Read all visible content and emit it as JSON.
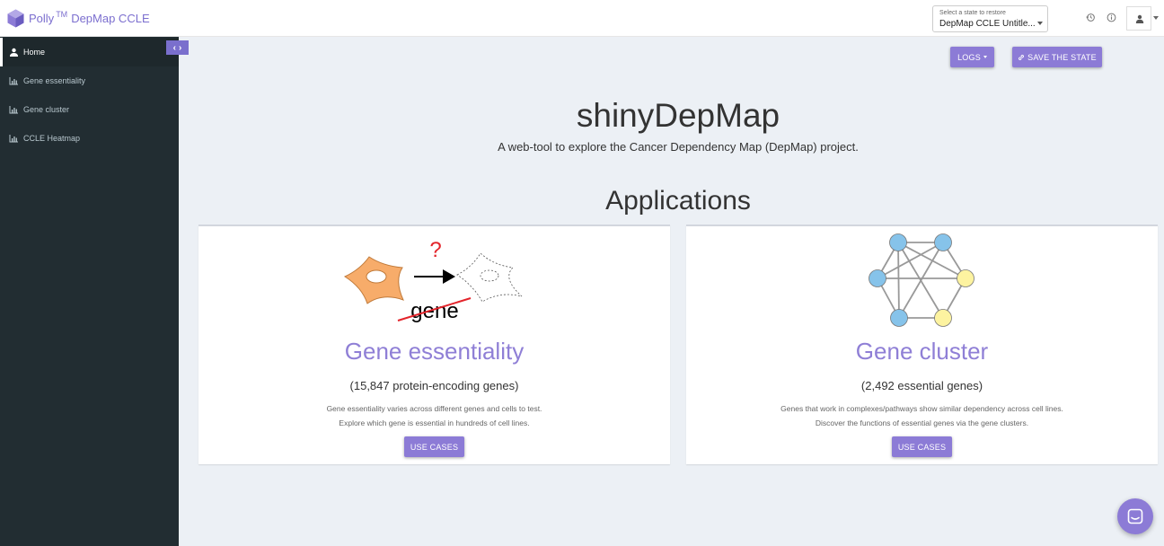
{
  "header": {
    "brand_name": "Polly",
    "brand_tm": "TM",
    "brand_rest": "DepMap CCLE",
    "state_selector": {
      "label": "Select a state to restore",
      "value": "DepMap CCLE Untitle..."
    },
    "icons": [
      "history-icon",
      "info-icon",
      "user-icon"
    ]
  },
  "sidebar": {
    "items": [
      {
        "label": "Home",
        "icon": "home-icon",
        "active": true
      },
      {
        "label": "Gene essentiality",
        "icon": "bar-chart-icon",
        "active": false
      },
      {
        "label": "Gene cluster",
        "icon": "bar-chart-icon",
        "active": false
      },
      {
        "label": "CCLE Heatmap",
        "icon": "bar-chart-icon",
        "active": false
      }
    ]
  },
  "toolbar": {
    "logs_label": "LOGS",
    "save_label": "SAVE THE STATE"
  },
  "main": {
    "title": "shinyDepMap",
    "subtitle": "A web-tool to explore the Cancer Dependency Map (DepMap) project.",
    "apps_heading": "Applications",
    "cards": [
      {
        "title": "Gene essentiality",
        "count": "(15,847 protein-encoding genes)",
        "desc_line1": "Gene essentiality varies across different genes and cells to test.",
        "desc_line2": "Explore which gene is essential in hundreds of cell lines.",
        "button": "USE CASES",
        "image_question": "?",
        "image_word": "gene"
      },
      {
        "title": "Gene cluster",
        "count": "(2,492 essential genes)",
        "desc_line1": "Genes that work in complexes/pathways show similar dependency across cell lines.",
        "desc_line2": "Discover the functions of essential genes via the gene clusters.",
        "button": "USE CASES"
      }
    ]
  },
  "colors": {
    "accent": "#8c7bd6",
    "sidebar_bg": "#222d32",
    "content_bg": "#ecf0f5",
    "node_blue": "#86c3ea",
    "node_yellow": "#fdf3a0",
    "cell_orange": "#f7ac6a"
  }
}
